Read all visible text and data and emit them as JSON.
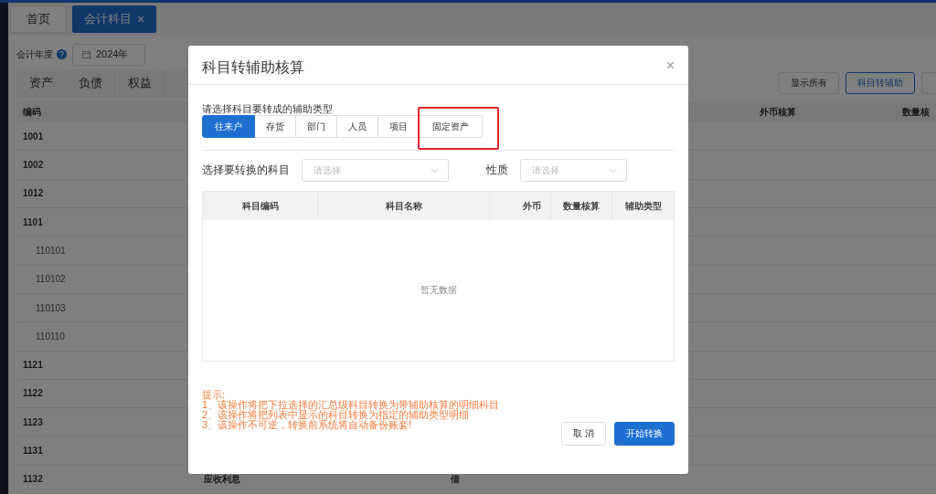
{
  "page_tabs": [
    {
      "label": "首页",
      "selected": false,
      "closable": false
    },
    {
      "label": "会计科目",
      "selected": true,
      "closable": true,
      "close_glyph": "×"
    }
  ],
  "filter": {
    "label": "会计年度",
    "year": "2024年"
  },
  "category_tabs": [
    {
      "label": "资产"
    },
    {
      "label": "负债"
    },
    {
      "label": "权益"
    }
  ],
  "toolbar_buttons": [
    {
      "label": "显示所有",
      "primary": false
    },
    {
      "label": "科目转辅助",
      "primary": true
    },
    {
      "primary": false
    }
  ],
  "table": {
    "columns": [
      "编码",
      "",
      "",
      "外币核算",
      "数量核"
    ],
    "rows": [
      {
        "code": "1001"
      },
      {
        "code": "1002"
      },
      {
        "code": "1012"
      },
      {
        "code": "1101",
        "children": [
          {
            "code": "110101"
          },
          {
            "code": "110102"
          },
          {
            "code": "110103"
          },
          {
            "code": "110110"
          }
        ]
      },
      {
        "code": "1121"
      },
      {
        "code": "1122"
      },
      {
        "code": "1123"
      },
      {
        "code": "1131"
      },
      {
        "code": "1132",
        "name": "应收利息",
        "direction": "借"
      }
    ]
  },
  "dialog": {
    "title": "科目转辅助核算",
    "close_glyph": "×",
    "type_prompt": "请选择科目要转成的辅助类型",
    "types": [
      {
        "label": "往来户",
        "selected": true,
        "highlighted": false
      },
      {
        "label": "存货",
        "selected": false,
        "highlighted": false
      },
      {
        "label": "部门",
        "selected": false,
        "highlighted": false
      },
      {
        "label": "人员",
        "selected": false,
        "highlighted": false
      },
      {
        "label": "项目",
        "selected": false,
        "highlighted": false
      },
      {
        "label": "固定资产",
        "selected": false,
        "highlighted": true
      }
    ],
    "account_label": "选择要转换的科目",
    "account_select": {
      "placeholder": "请选择"
    },
    "nature_label": "性质",
    "nature_select": {
      "placeholder": "请选择"
    },
    "table": {
      "columns": [
        "科目编码",
        "科目名称",
        "外币",
        "数量核算",
        "辅助类型"
      ],
      "empty_text": "暂无数据"
    },
    "tips": [
      "提示:",
      "1、该操作将把下拉选择的汇总级科目转换为带辅助核算的明细科目",
      "2、该操作将把列表中显示的科目转换为指定的辅助类型明细",
      "3、该操作不可逆，转换前系统将自动备份账套!"
    ],
    "buttons": [
      {
        "label": "取 消",
        "primary": false
      },
      {
        "label": "开始转换",
        "primary": true
      }
    ]
  }
}
